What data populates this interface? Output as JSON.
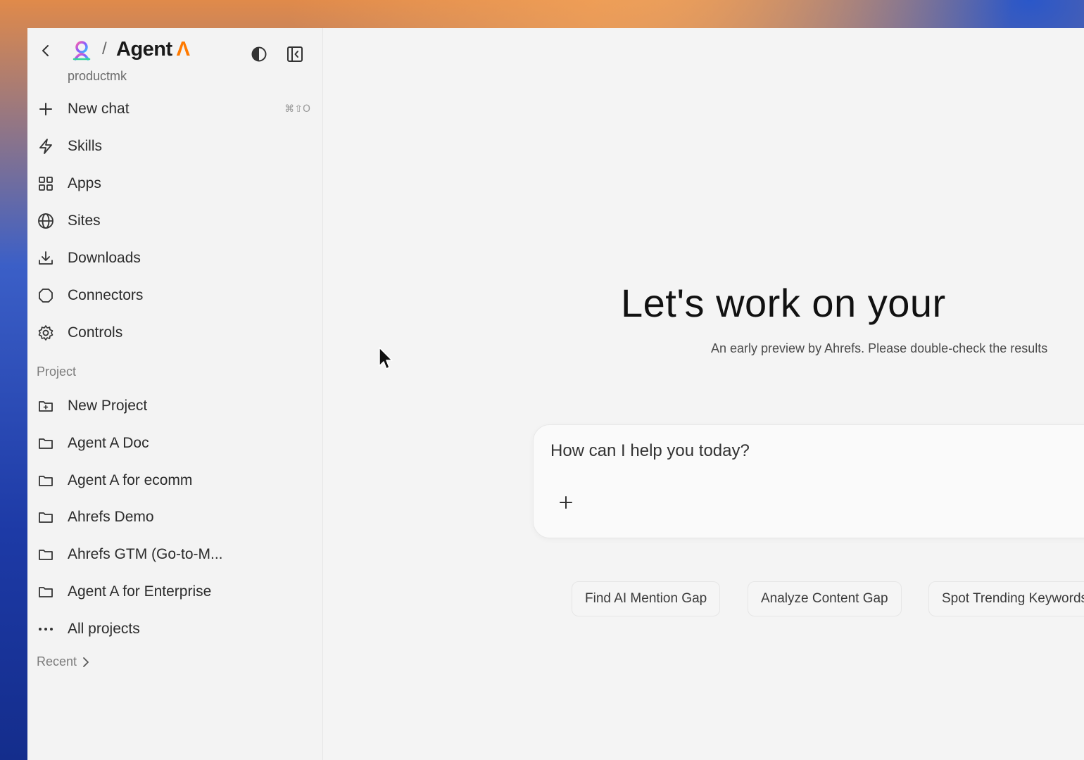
{
  "header": {
    "brand": "Agent",
    "brand_accent": "Λ",
    "workspace": "productmk"
  },
  "nav": {
    "new_chat": {
      "label": "New chat",
      "shortcut": "⌘⇧O"
    },
    "items": [
      {
        "label": "Skills",
        "icon": "lightning-icon"
      },
      {
        "label": "Apps",
        "icon": "grid-icon"
      },
      {
        "label": "Sites",
        "icon": "globe-icon"
      },
      {
        "label": "Downloads",
        "icon": "download-icon"
      },
      {
        "label": "Connectors",
        "icon": "plug-icon"
      },
      {
        "label": "Controls",
        "icon": "gear-icon"
      }
    ]
  },
  "projects": {
    "section_label": "Project",
    "new_project": "New Project",
    "items": [
      "Agent A Doc",
      "Agent A for ecomm",
      "Ahrefs Demo",
      "Ahrefs GTM (Go-to-M...",
      "Agent A for Enterprise"
    ],
    "all_projects": "All projects"
  },
  "recent": {
    "label": "Recent"
  },
  "main": {
    "headline": "Let's work on your",
    "subline": "An early preview by Ahrefs. Please double-check the results",
    "composer": {
      "placeholder": "How can I help you today?"
    },
    "chips": [
      "Find AI Mention Gap",
      "Analyze Content Gap",
      "Spot Trending Keywords"
    ]
  },
  "colors": {
    "accent": "#ff7a00",
    "sidebar_bg": "#f3f3f3",
    "main_bg": "#f4f4f4"
  }
}
